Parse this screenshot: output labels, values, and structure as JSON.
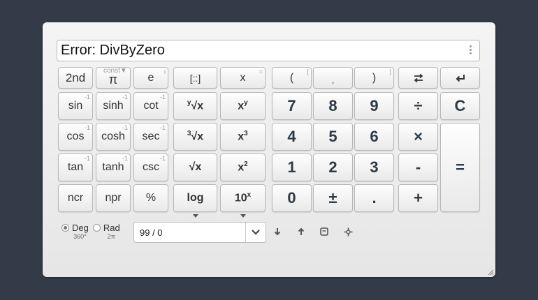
{
  "display": {
    "text": "Error: DivByZero"
  },
  "func_buttons": {
    "second": "2nd",
    "pi": "π",
    "pi_tag": "const▼",
    "e": "e",
    "e_tag": "i",
    "matrix": "[::]",
    "x": "x",
    "x_tag": "=",
    "sin": "sin",
    "sinh": "sinh",
    "cot": "cot",
    "cos": "cos",
    "cosh": "cosh",
    "sec": "sec",
    "tan": "tan",
    "tanh": "tanh",
    "csc": "csc",
    "ncr": "ncr",
    "npr": "npr",
    "percent": "%",
    "inverse_tag": "-1",
    "yroot": "√x",
    "yroot_index": "y",
    "xpow": "x",
    "xpow_sup": "y",
    "cuberoot": "√x",
    "cuberoot_index": "3",
    "cube": "x",
    "cube_sup": "3",
    "sqrt": "√x",
    "square": "x",
    "square_sup": "2",
    "log": "log",
    "ten": "10",
    "ten_sup": "x"
  },
  "num_buttons": {
    "lparen": "(",
    "lparen_tag": "[",
    "comma": ",",
    "rparen": ")",
    "rparen_tag": "]",
    "seven": "7",
    "eight": "8",
    "nine": "9",
    "four": "4",
    "five": "5",
    "six": "6",
    "one": "1",
    "two": "2",
    "three": "3",
    "zero": "0",
    "plusminus": "±",
    "dot": ".",
    "divide": "÷",
    "clear": "C",
    "multiply": "×",
    "minus": "-",
    "plus": "+",
    "equals": "="
  },
  "modes": {
    "deg": "Deg",
    "deg_sub": "360°",
    "rad": "Rad",
    "rad_sub": "2π",
    "selected": "Deg"
  },
  "expression": {
    "value": "99 / 0"
  },
  "icons": [
    "swap-icon",
    "backspace-icon",
    "menu-dots-icon",
    "chevron-down-icon",
    "arrow-down-icon",
    "arrow-up-icon",
    "window-icon",
    "crosshair-icon",
    "resize-grip-icon"
  ]
}
